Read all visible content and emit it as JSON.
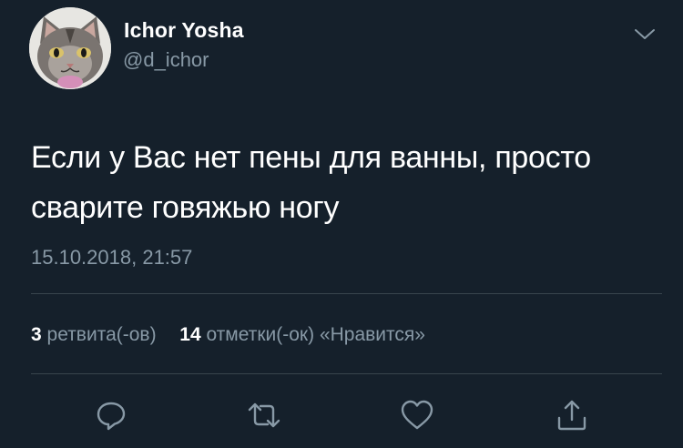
{
  "tweet": {
    "display_name": "Ichor Yosha",
    "handle": "@d_ichor",
    "text_line1": "Если у Вас нет пены для ванны, просто",
    "text_line2": "сварите говяжью ногу",
    "timestamp": "15.10.2018, 21:57"
  },
  "stats": {
    "retweets_count": "3",
    "retweets_label": "ретвита(-ов)",
    "likes_count": "14",
    "likes_label": "отметки(-ок) «Нравится»"
  },
  "icons": {
    "avatar": "cat-avatar-image",
    "menu": "chevron-down-icon",
    "reply": "reply-icon",
    "retweet": "retweet-icon",
    "like": "heart-icon",
    "share": "share-icon"
  },
  "colors": {
    "background": "#15202b",
    "primary_text": "#ffffff",
    "secondary_text": "#8899a6",
    "divider": "#38444d"
  }
}
